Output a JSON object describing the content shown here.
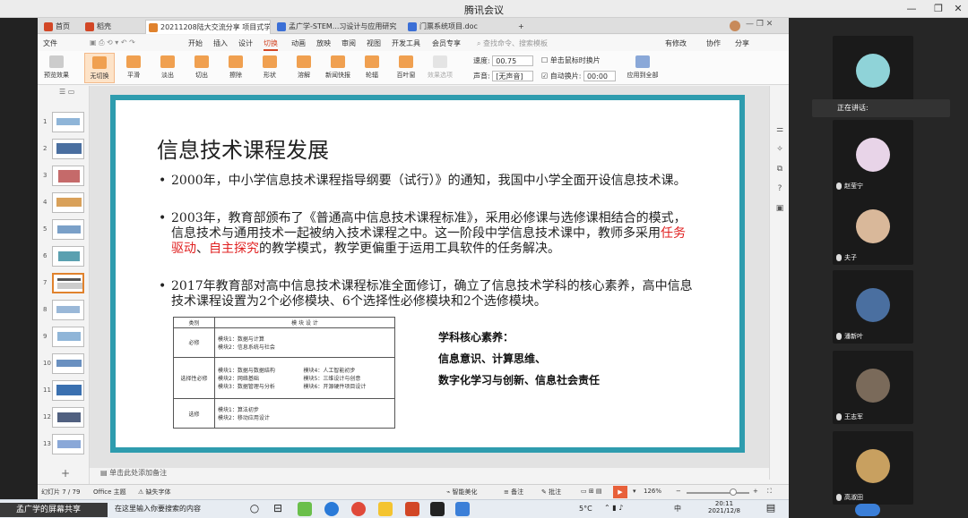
{
  "meeting": {
    "title": "腾讯会议"
  },
  "tabs": [
    {
      "label": "首页",
      "color": "#d24726"
    },
    {
      "label": "稻壳",
      "color": "#d24726"
    },
    {
      "label": "20211208陆大交流分享 项目式学习 ●",
      "color": "#e0822d"
    },
    {
      "label": "孟广学-STEM...习设计与应用研究",
      "color": "#3b6fd6"
    },
    {
      "label": "门票系统项目.doc",
      "color": "#3b6fd6"
    }
  ],
  "menu": {
    "file": "文件",
    "items": [
      "开始",
      "插入",
      "设计",
      "切换",
      "动画",
      "放映",
      "审阅",
      "视图",
      "开发工具",
      "会员专享"
    ],
    "selected_index": 3,
    "search": "查找命令、搜索模板",
    "right": [
      "有修改",
      "协作",
      "分享"
    ]
  },
  "ribbon": {
    "preview": "预览效果",
    "transitions": [
      "无切换",
      "平滑",
      "淡出",
      "切出",
      "擦除",
      "形状",
      "溶解",
      "新闻快报",
      "轮辐",
      "百叶窗"
    ],
    "effect_options": "效果选项",
    "speed_label": "速度:",
    "speed_value": "00.75",
    "sound_label": "声音:",
    "sound_value": "[无声音]",
    "click_advance": "单击鼠标时换片",
    "auto_advance": "自动换片:",
    "auto_value": "00:00",
    "apply_all": "应用到全部"
  },
  "slide": {
    "title": "信息技术课程发展",
    "bullets": [
      {
        "text": "2000年，中小学信息技术课程指导纲要（试行）》的通知，我国中小学全面开设信息技术课。"
      },
      {
        "pre": "2003年，教育部颁布了《普通高中信息技术课程标准》，采用必修课与选修课相结合的模式，信息技术与通用技术一起被纳入技术课程之中。这一阶段中学信息技术课中，教师多采用",
        "hl1": "任务驱动",
        "mid": "、",
        "hl2": "自主探究",
        "post": "的教学模式，教学更偏重于运用工具软件的任务解决。"
      },
      {
        "text": "2017年教育部对高中信息技术课程标准全面修订，确立了信息技术学科的核心素养，高中信息技术课程设置为2个必修模块、6个选择性必修模块和2个选修模块。"
      }
    ],
    "table": {
      "headers": [
        "类别",
        "模 块 设 计"
      ],
      "rows": [
        {
          "cat": "必修",
          "col1": [
            "模块1：数据与计算",
            "模块2：信息系统与社会"
          ],
          "col2": []
        },
        {
          "cat": "选择性必修",
          "col1": [
            "模块1：数据与数据结构",
            "模块2：网络基础",
            "模块3：数据管理与分析"
          ],
          "col2": [
            "模块4：人工智能初步",
            "模块5：三维设计与创意",
            "模块6：开源硬件项目设计"
          ]
        },
        {
          "cat": "选修",
          "col1": [
            "模块1：算法初步",
            "模块2：移动应用设计"
          ],
          "col2": []
        }
      ]
    },
    "core": {
      "heading": "学科核心素养：",
      "line1": "信息意识、计算思维、",
      "line2": "数字化学习与创新、信息社会责任"
    }
  },
  "thumbnails": [
    "1",
    "2",
    "3",
    "4",
    "5",
    "6",
    "7",
    "8",
    "9",
    "10",
    "11",
    "12",
    "13"
  ],
  "notes": "单击此处添加备注",
  "status": {
    "slide_counter": "幻灯片 7 / 79",
    "theme": "Office 主题",
    "missing_font": "缺失字体",
    "smart_beautify": "智能美化",
    "notes_btn": "备注",
    "comment_btn": "批注",
    "zoom": "126%"
  },
  "taskbar": {
    "search_placeholder": "在这里输入你要搜索的内容",
    "weather": "5°C",
    "lang": "中",
    "time": "20:11",
    "date": "2021/12/8"
  },
  "share_label": "孟广学的屏幕共享",
  "speaking": "正在讲话:",
  "participants": [
    {
      "name": "",
      "color": "#8fd3d8"
    },
    {
      "name": "赵莹宁",
      "color": "#e8d4e8"
    },
    {
      "name": "夫子",
      "color": "#d9b89a"
    },
    {
      "name": "潘新叶",
      "color": "#4a6fa0"
    },
    {
      "name": "王志军",
      "color": "#7a6a5a"
    },
    {
      "name": "高淑田",
      "color": "#c8a060"
    }
  ]
}
